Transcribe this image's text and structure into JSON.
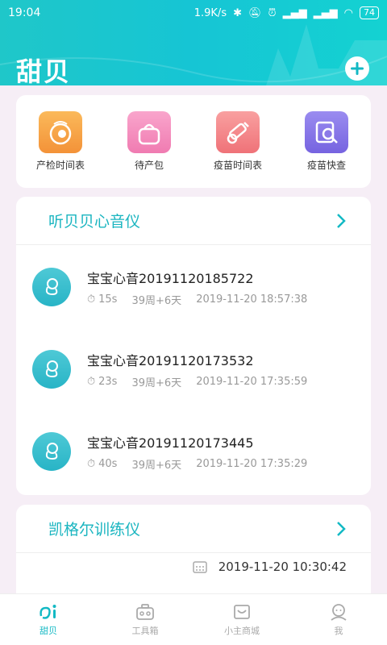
{
  "status_bar": {
    "time": "19:04",
    "network_speed": "1.9K/s",
    "battery": "74"
  },
  "header": {
    "title": "甜贝"
  },
  "quick_actions": [
    {
      "label": "产检时间表",
      "icon": "prenatal-check-icon",
      "color": "#f6a548"
    },
    {
      "label": "待产包",
      "icon": "bag-icon",
      "color": "#f48bbd"
    },
    {
      "label": "疫苗时间表",
      "icon": "vaccine-schedule-icon",
      "color": "#f3848a"
    },
    {
      "label": "疫苗快查",
      "icon": "vaccine-search-icon",
      "color": "#8b79e8"
    }
  ],
  "heart_monitor": {
    "title": "听贝贝心音仪",
    "records": [
      {
        "name": "宝宝心音20191120185722",
        "duration": "15s",
        "week": "39周+6天",
        "datetime": "2019-11-20 18:57:38"
      },
      {
        "name": "宝宝心音20191120173532",
        "duration": "23s",
        "week": "39周+6天",
        "datetime": "2019-11-20 17:35:59"
      },
      {
        "name": "宝宝心音20191120173445",
        "duration": "40s",
        "week": "39周+6天",
        "datetime": "2019-11-20 17:35:29"
      }
    ]
  },
  "kegel": {
    "title": "凯格尔训练仪",
    "latest_datetime": "2019-11-20 10:30:42"
  },
  "tabbar": {
    "tabs": [
      {
        "label": "甜贝",
        "icon": "home-icon"
      },
      {
        "label": "工具箱",
        "icon": "toolbox-icon"
      },
      {
        "label": "小主商城",
        "icon": "mall-icon"
      },
      {
        "label": "我",
        "icon": "profile-icon"
      }
    ]
  },
  "colors": {
    "accent": "#13b9c4",
    "header_gradient_start": "#1fc7c9",
    "header_gradient_end": "#14d2d2"
  }
}
